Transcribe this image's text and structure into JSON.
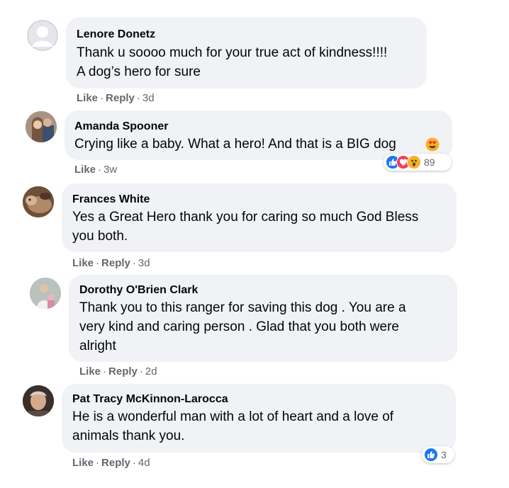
{
  "comments": [
    {
      "author": "Lenore Donetz",
      "lines": [
        "Thank u soooo much for your true act of kindness!!!!",
        "A dog’s hero for sure"
      ],
      "actions": {
        "like": "Like",
        "reply": "Reply",
        "time": "3d"
      }
    },
    {
      "author": "Amanda Spooner",
      "lines": [
        "Crying like a baby. What a hero! And that is a BIG dog"
      ],
      "emoji": "heart-eyes",
      "actions": {
        "like": "Like",
        "time": "3w"
      },
      "reactions": {
        "count": "89",
        "icons": [
          "like-reaction",
          "love-reaction",
          "wow-reaction"
        ]
      }
    },
    {
      "author": "Frances White",
      "lines": [
        "Yes a Great Hero thank you for caring so much God Bless",
        "you both."
      ],
      "actions": {
        "like": "Like",
        "reply": "Reply",
        "time": "3d"
      }
    },
    {
      "author": "Dorothy O'Brien Clark",
      "lines": [
        "Thank you to this ranger for saving this dog . You are a",
        "very kind and caring person . Glad that you both were",
        "alright"
      ],
      "actions": {
        "like": "Like",
        "reply": "Reply",
        "time": "2d"
      }
    },
    {
      "author": "Pat Tracy McKinnon-Larocca",
      "lines": [
        "He is a wonderful man with a lot of heart and a love of",
        "animals thank you."
      ],
      "actions": {
        "like": "Like",
        "reply": "Reply",
        "time": "4d"
      },
      "reactions": {
        "count": "3",
        "icons": [
          "like-reaction"
        ]
      }
    }
  ],
  "separator": "·",
  "colors": {
    "bubble": "#f0f2f5",
    "meta": "#65676b",
    "like": "#1877f2",
    "love": "#f33e58",
    "wow": "#f7b125"
  }
}
